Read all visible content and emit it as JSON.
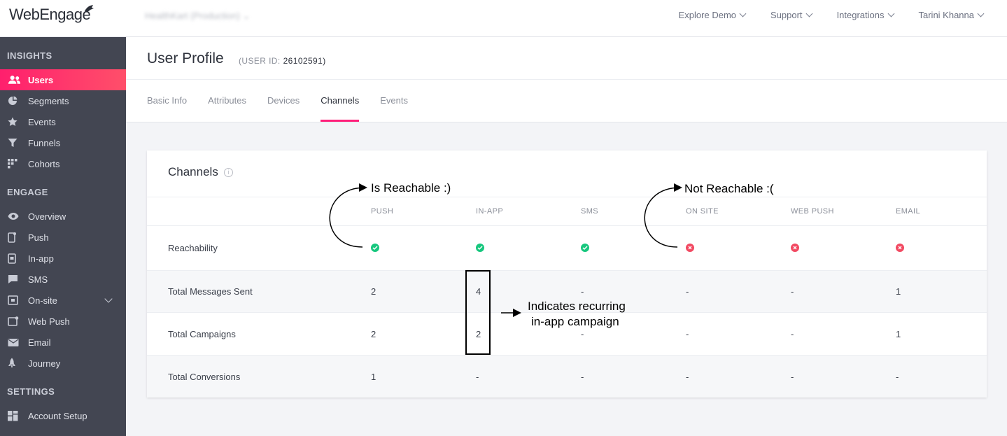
{
  "app": {
    "brand": "WebEngage",
    "project": "HealthKart (Production)"
  },
  "topnav": [
    {
      "label": "Explore Demo"
    },
    {
      "label": "Support"
    },
    {
      "label": "Integrations"
    },
    {
      "label": "Tarini Khanna"
    }
  ],
  "sidebar": {
    "sections": [
      "INSIGHTS",
      "ENGAGE",
      "SETTINGS"
    ],
    "items": [
      {
        "label": "Users",
        "icon": "users-icon"
      },
      {
        "label": "Segments",
        "icon": "pie-icon"
      },
      {
        "label": "Events",
        "icon": "star-icon"
      },
      {
        "label": "Funnels",
        "icon": "funnel-icon"
      },
      {
        "label": "Cohorts",
        "icon": "grid-icon"
      },
      {
        "label": "Overview",
        "icon": "eye-icon"
      },
      {
        "label": "Push",
        "icon": "mobile-icon"
      },
      {
        "label": "In-app",
        "icon": "in-app-icon"
      },
      {
        "label": "SMS",
        "icon": "sms-icon"
      },
      {
        "label": "On-site",
        "icon": "on-site-icon"
      },
      {
        "label": "Web Push",
        "icon": "web-push-icon"
      },
      {
        "label": "Email",
        "icon": "email-icon"
      },
      {
        "label": "Journey",
        "icon": "rocket-icon"
      },
      {
        "label": "Account Setup",
        "icon": "account-setup-icon"
      }
    ]
  },
  "page": {
    "title": "User Profile",
    "user_id_label": "(USER ID:",
    "user_id_value": "26102591)",
    "tabs": [
      "Basic Info",
      "Attributes",
      "Devices",
      "Channels",
      "Events"
    ]
  },
  "card": {
    "title": "Channels",
    "columns": [
      "PUSH",
      "IN-APP",
      "SMS",
      "ON SITE",
      "WEB PUSH",
      "EMAIL"
    ],
    "rows": [
      {
        "label": "Reachability",
        "reachable": [
          true,
          true,
          true,
          false,
          false,
          false
        ]
      },
      {
        "label": "Total Messages Sent",
        "values": [
          "2",
          "4",
          "-",
          "-",
          "-",
          "1"
        ]
      },
      {
        "label": "Total Campaigns",
        "values": [
          "2",
          "2",
          "-",
          "-",
          "-",
          "1"
        ]
      },
      {
        "label": "Total Conversions",
        "values": [
          "1",
          "-",
          "-",
          "-",
          "-",
          "-"
        ]
      }
    ]
  },
  "annotations": {
    "reachable": "Is Reachable :)",
    "not_reachable": "Not Reachable :(",
    "recurring_line1": "Indicates recurring",
    "recurring_line2": "in-app campaign"
  },
  "colors": {
    "accent": "#ff1f6d",
    "reachable": "#17c77e",
    "not_reachable": "#f24a62",
    "sidebar": "#434652"
  }
}
